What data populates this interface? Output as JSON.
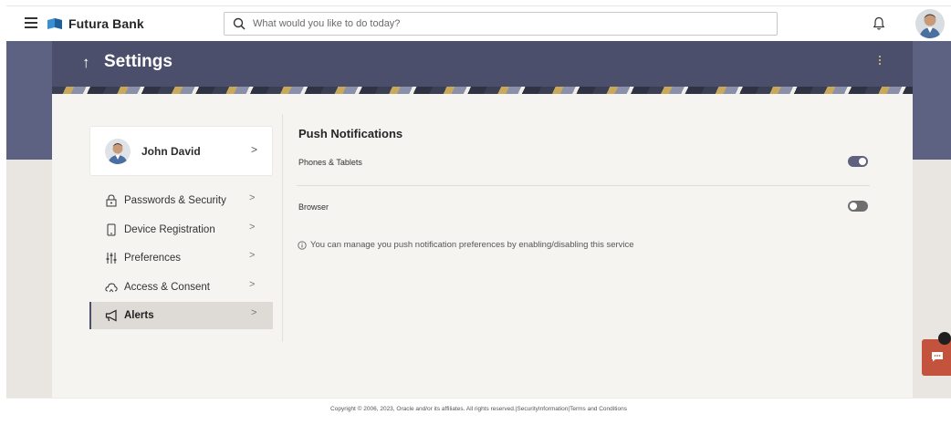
{
  "header": {
    "brand": "Futura Bank",
    "search_placeholder": "What would you like to do today?"
  },
  "page": {
    "title": "Settings"
  },
  "profile": {
    "name": "John David"
  },
  "nav": {
    "items": [
      {
        "label": "Passwords & Security",
        "icon": "lock-icon",
        "active": false
      },
      {
        "label": "Device Registration",
        "icon": "device-icon",
        "active": false
      },
      {
        "label": "Preferences",
        "icon": "sliders-icon",
        "active": false
      },
      {
        "label": "Access & Consent",
        "icon": "cloud-icon",
        "active": false
      },
      {
        "label": "Alerts",
        "icon": "megaphone-icon",
        "active": true
      }
    ]
  },
  "push": {
    "title": "Push Notifications",
    "rows": [
      {
        "label": "Phones & Tablets",
        "enabled": true
      },
      {
        "label": "Browser",
        "enabled": false
      }
    ],
    "info": "You can manage you push notification preferences by enabling/disabling this service"
  },
  "footer": {
    "text": "Copyright © 2006, 2023, Oracle and/or its affiliates. All rights reserved.|SecurityInformation|Terms and Conditions"
  },
  "colors": {
    "primary": "#4b4f6b",
    "band": "#5d6282",
    "toggle_on": "#5e627f",
    "toggle_off": "#6e6e6e",
    "chat_fab": "#c4533d"
  }
}
